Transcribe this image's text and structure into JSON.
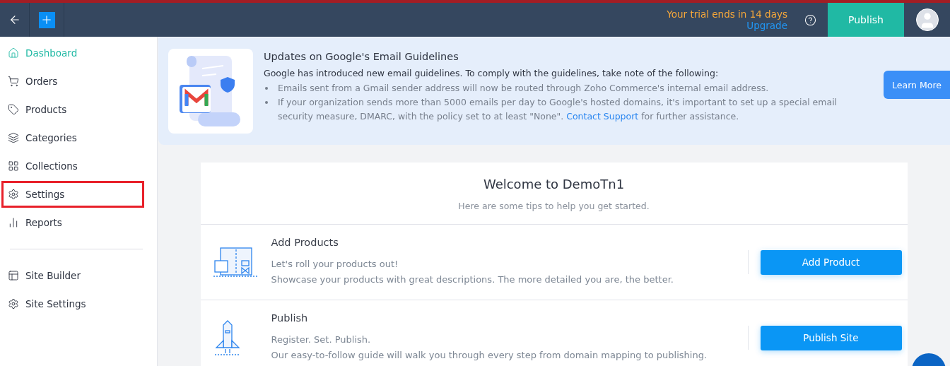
{
  "header": {
    "trial_notice": "Your trial ends in 14 days",
    "upgrade_link": "Upgrade",
    "publish_button": "Publish"
  },
  "sidebar": {
    "groups": [
      [
        {
          "label": "Dashboard",
          "selected": true,
          "highlighted": false
        },
        {
          "label": "Orders",
          "selected": false,
          "highlighted": false
        },
        {
          "label": "Products",
          "selected": false,
          "highlighted": false
        },
        {
          "label": "Categories",
          "selected": false,
          "highlighted": false
        },
        {
          "label": "Collections",
          "selected": false,
          "highlighted": false
        },
        {
          "label": "Settings",
          "selected": false,
          "highlighted": true
        },
        {
          "label": "Reports",
          "selected": false,
          "highlighted": false
        }
      ],
      [
        {
          "label": "Site Builder",
          "selected": false,
          "highlighted": false
        },
        {
          "label": "Site Settings",
          "selected": false,
          "highlighted": false
        }
      ]
    ]
  },
  "banner": {
    "title": "Updates on Google's Email Guidelines",
    "intro": "Google has introduced new email guidelines. To comply with the guidelines, take note of the following:",
    "bullets": [
      {
        "text": "Emails sent from a Gmail sender address will now be routed through Zoho Commerce's internal email address."
      },
      {
        "text": "If your organization sends more than 5000 emails per day to Google's hosted domains, it's important to set up a special email security measure, DMARC, with the policy set to at least \"None\".",
        "link": "Contact Support",
        "after": "for further assistance."
      }
    ],
    "button": "Learn More"
  },
  "welcome": {
    "title": "Welcome to DemoTn1",
    "subtitle": "Here are some tips to help you get started.",
    "steps": [
      {
        "title": "Add Products",
        "lines": [
          "Let's roll your products out!",
          "Showcase your products with great descriptions. The more detailed you are, the better."
        ],
        "button": "Add Product"
      },
      {
        "title": "Publish",
        "lines": [
          "Register. Set. Publish.",
          "Our easy-to-follow guide will walk you through every step from domain mapping to publishing."
        ],
        "button": "Publish Site"
      }
    ]
  }
}
